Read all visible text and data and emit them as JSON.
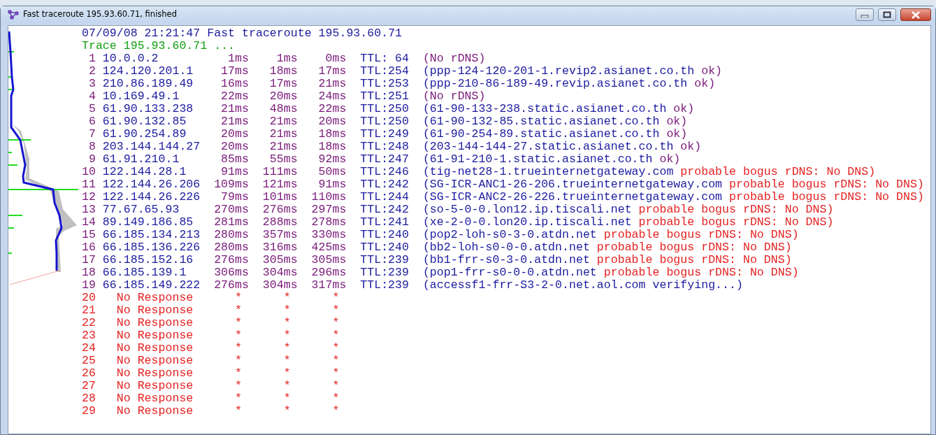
{
  "window": {
    "title": "Fast traceroute 195.93.60.71, finished"
  },
  "header": {
    "timestamp_line": "07/09/08 21:21:47 Fast traceroute 195.93.60.71",
    "status_line": "Trace 195.93.60.71 ..."
  },
  "hops": [
    {
      "kind": "reply",
      "hop": "1",
      "ip": "10.0.0.2",
      "times": [
        "1ms",
        "1ms",
        "0ms"
      ],
      "ttl": "TTL: 64",
      "rdns": "(No rDNS)",
      "resolved": false
    },
    {
      "kind": "reply",
      "hop": "2",
      "ip": "124.120.201.1",
      "times": [
        "17ms",
        "18ms",
        "17ms"
      ],
      "ttl": "TTL:254",
      "rdns": "(ppp-124-120-201-1.revip2.asianet.co.th",
      "note": "ok)",
      "resolved": true,
      "flagged": false
    },
    {
      "kind": "reply",
      "hop": "3",
      "ip": "210.86.189.49",
      "times": [
        "16ms",
        "17ms",
        "21ms"
      ],
      "ttl": "TTL:253",
      "rdns": "(ppp-210-86-189-49.revip.asianet.co.th",
      "note": "ok)",
      "resolved": true,
      "flagged": false
    },
    {
      "kind": "reply",
      "hop": "4",
      "ip": "10.169.49.1",
      "times": [
        "22ms",
        "20ms",
        "24ms"
      ],
      "ttl": "TTL:251",
      "rdns": "(No rDNS)",
      "resolved": false
    },
    {
      "kind": "reply",
      "hop": "5",
      "ip": "61.90.133.238",
      "times": [
        "21ms",
        "48ms",
        "22ms"
      ],
      "ttl": "TTL:250",
      "rdns": "(61-90-133-238.static.asianet.co.th",
      "note": "ok)",
      "resolved": true,
      "flagged": false
    },
    {
      "kind": "reply",
      "hop": "6",
      "ip": "61.90.132.85",
      "times": [
        "21ms",
        "21ms",
        "20ms"
      ],
      "ttl": "TTL:250",
      "rdns": "(61-90-132-85.static.asianet.co.th",
      "note": "ok)",
      "resolved": true,
      "flagged": false
    },
    {
      "kind": "reply",
      "hop": "7",
      "ip": "61.90.254.89",
      "times": [
        "20ms",
        "21ms",
        "18ms"
      ],
      "ttl": "TTL:249",
      "rdns": "(61-90-254-89.static.asianet.co.th",
      "note": "ok)",
      "resolved": true,
      "flagged": false
    },
    {
      "kind": "reply",
      "hop": "8",
      "ip": "203.144.144.27",
      "times": [
        "20ms",
        "21ms",
        "18ms"
      ],
      "ttl": "TTL:248",
      "rdns": "(203-144-144-27.static.asianet.co.th",
      "note": "ok)",
      "resolved": true,
      "flagged": false
    },
    {
      "kind": "reply",
      "hop": "9",
      "ip": "61.91.210.1",
      "times": [
        "85ms",
        "55ms",
        "92ms"
      ],
      "ttl": "TTL:247",
      "rdns": "(61-91-210-1.static.asianet.co.th",
      "note": "ok)",
      "resolved": true,
      "flagged": false
    },
    {
      "kind": "reply",
      "hop": "10",
      "ip": "122.144.28.1",
      "times": [
        "91ms",
        "111ms",
        "50ms"
      ],
      "ttl": "TTL:246",
      "rdns": "(tig-net28-1.trueinternetgateway.com",
      "note": "probable bogus rDNS: No DNS)",
      "resolved": true,
      "flagged": true
    },
    {
      "kind": "reply",
      "hop": "11",
      "ip": "122.144.26.206",
      "times": [
        "109ms",
        "121ms",
        "91ms"
      ],
      "ttl": "TTL:242",
      "rdns": "(SG-ICR-ANC1-26-206.trueinternetgateway.com",
      "note": "probable bogus rDNS: No DNS)",
      "resolved": true,
      "flagged": true
    },
    {
      "kind": "reply",
      "hop": "12",
      "ip": "122.144.26.226",
      "times": [
        "79ms",
        "101ms",
        "110ms"
      ],
      "ttl": "TTL:244",
      "rdns": "(SG-ICR-ANC2-26-226.trueinternetgateway.com",
      "note": "probable bogus rDNS: No DNS)",
      "resolved": true,
      "flagged": true
    },
    {
      "kind": "reply",
      "hop": "13",
      "ip": "77.67.65.93",
      "times": [
        "270ms",
        "276ms",
        "297ms"
      ],
      "ttl": "TTL:242",
      "rdns": "(so-5-0-0.lon12.ip.tiscali.net",
      "note": "probable bogus rDNS: No DNS)",
      "resolved": true,
      "flagged": true
    },
    {
      "kind": "reply",
      "hop": "14",
      "ip": "89.149.186.85",
      "times": [
        "281ms",
        "288ms",
        "278ms"
      ],
      "ttl": "TTL:241",
      "rdns": "(xe-2-0-0.lon20.ip.tiscali.net",
      "note": "probable bogus rDNS: No DNS)",
      "resolved": true,
      "flagged": true
    },
    {
      "kind": "reply",
      "hop": "15",
      "ip": "66.185.134.213",
      "times": [
        "280ms",
        "357ms",
        "330ms"
      ],
      "ttl": "TTL:240",
      "rdns": "(pop2-loh-s0-3-0.atdn.net",
      "note": "probable bogus rDNS: No DNS)",
      "resolved": true,
      "flagged": true
    },
    {
      "kind": "reply",
      "hop": "16",
      "ip": "66.185.136.226",
      "times": [
        "280ms",
        "316ms",
        "425ms"
      ],
      "ttl": "TTL:240",
      "rdns": "(bb2-loh-s0-0-0.atdn.net",
      "note": "probable bogus rDNS: No DNS)",
      "resolved": true,
      "flagged": true
    },
    {
      "kind": "reply",
      "hop": "17",
      "ip": "66.185.152.16",
      "times": [
        "276ms",
        "305ms",
        "305ms"
      ],
      "ttl": "TTL:239",
      "rdns": "(bb1-frr-s0-3-0.atdn.net",
      "note": "probable bogus rDNS: No DNS)",
      "resolved": true,
      "flagged": true
    },
    {
      "kind": "reply",
      "hop": "18",
      "ip": "66.185.139.1",
      "times": [
        "306ms",
        "304ms",
        "296ms"
      ],
      "ttl": "TTL:239",
      "rdns": "(pop1-frr-s0-0-0.atdn.net",
      "note": "probable bogus rDNS: No DNS)",
      "resolved": true,
      "flagged": true
    },
    {
      "kind": "reply",
      "hop": "19",
      "ip": "66.185.149.222",
      "times": [
        "276ms",
        "304ms",
        "317ms"
      ],
      "ttl": "TTL:239",
      "rdns": "(accessf1-frr-S3-2-0.net.aol.com verifying...)",
      "resolved": true
    },
    {
      "kind": "timeout",
      "hop": "20",
      "label": "No Response",
      "times": [
        "*",
        "*",
        "*"
      ]
    },
    {
      "kind": "timeout",
      "hop": "21",
      "label": "No Response",
      "times": [
        "*",
        "*",
        "*"
      ]
    },
    {
      "kind": "timeout",
      "hop": "22",
      "label": "No Response",
      "times": [
        "*",
        "*",
        "*"
      ]
    },
    {
      "kind": "timeout",
      "hop": "23",
      "label": "No Response",
      "times": [
        "*",
        "*",
        "*"
      ]
    },
    {
      "kind": "timeout",
      "hop": "24",
      "label": "No Response",
      "times": [
        "*",
        "*",
        "*"
      ]
    },
    {
      "kind": "timeout",
      "hop": "25",
      "label": "No Response",
      "times": [
        "*",
        "*",
        "*"
      ]
    },
    {
      "kind": "timeout",
      "hop": "26",
      "label": "No Response",
      "times": [
        "*",
        "*",
        "*"
      ]
    },
    {
      "kind": "timeout",
      "hop": "27",
      "label": "No Response",
      "times": [
        "*",
        "*",
        "*"
      ]
    },
    {
      "kind": "timeout",
      "hop": "28",
      "label": "No Response",
      "times": [
        "*",
        "*",
        "*"
      ]
    },
    {
      "kind": "timeout",
      "hop": "29",
      "label": "No Response",
      "times": [
        "*",
        "*",
        "*"
      ]
    }
  ]
}
